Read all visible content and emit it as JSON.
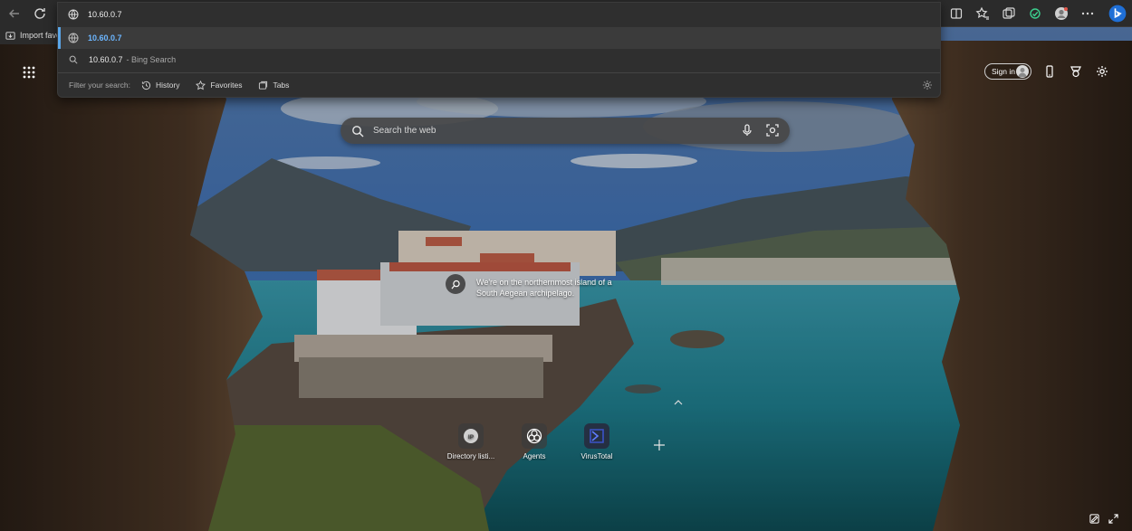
{
  "address_bar": {
    "url": "10.60.0.7"
  },
  "suggestions": [
    {
      "text": "10.60.0.7",
      "type": "url",
      "icon": "globe-icon"
    },
    {
      "text": "10.60.0.7",
      "suffix": "- Bing Search",
      "type": "search",
      "icon": "search-icon"
    }
  ],
  "filter": {
    "label": "Filter your search:",
    "chips": [
      {
        "label": "History",
        "icon": "history-icon"
      },
      {
        "label": "Favorites",
        "icon": "star-icon"
      },
      {
        "label": "Tabs",
        "icon": "tabs-icon"
      }
    ]
  },
  "favorites_bar": {
    "import_label": "Import favo"
  },
  "newtab": {
    "signin_label": "Sign in",
    "search_placeholder": "Search the web",
    "caption": "We're on the northernmost island of a South Aegean archipelago.",
    "quick_links": [
      {
        "label": "Directory listi...",
        "icon": "ip-icon"
      },
      {
        "label": "Agents",
        "icon": "agents-icon"
      },
      {
        "label": "VirusTotal",
        "icon": "virustotal-icon"
      }
    ]
  },
  "colors": {
    "toolbar_bg": "#2b2b2b",
    "dropdown_bg": "#2f2f2f",
    "selected_row": "#3b3b3b",
    "accent": "#6cb6ff"
  }
}
